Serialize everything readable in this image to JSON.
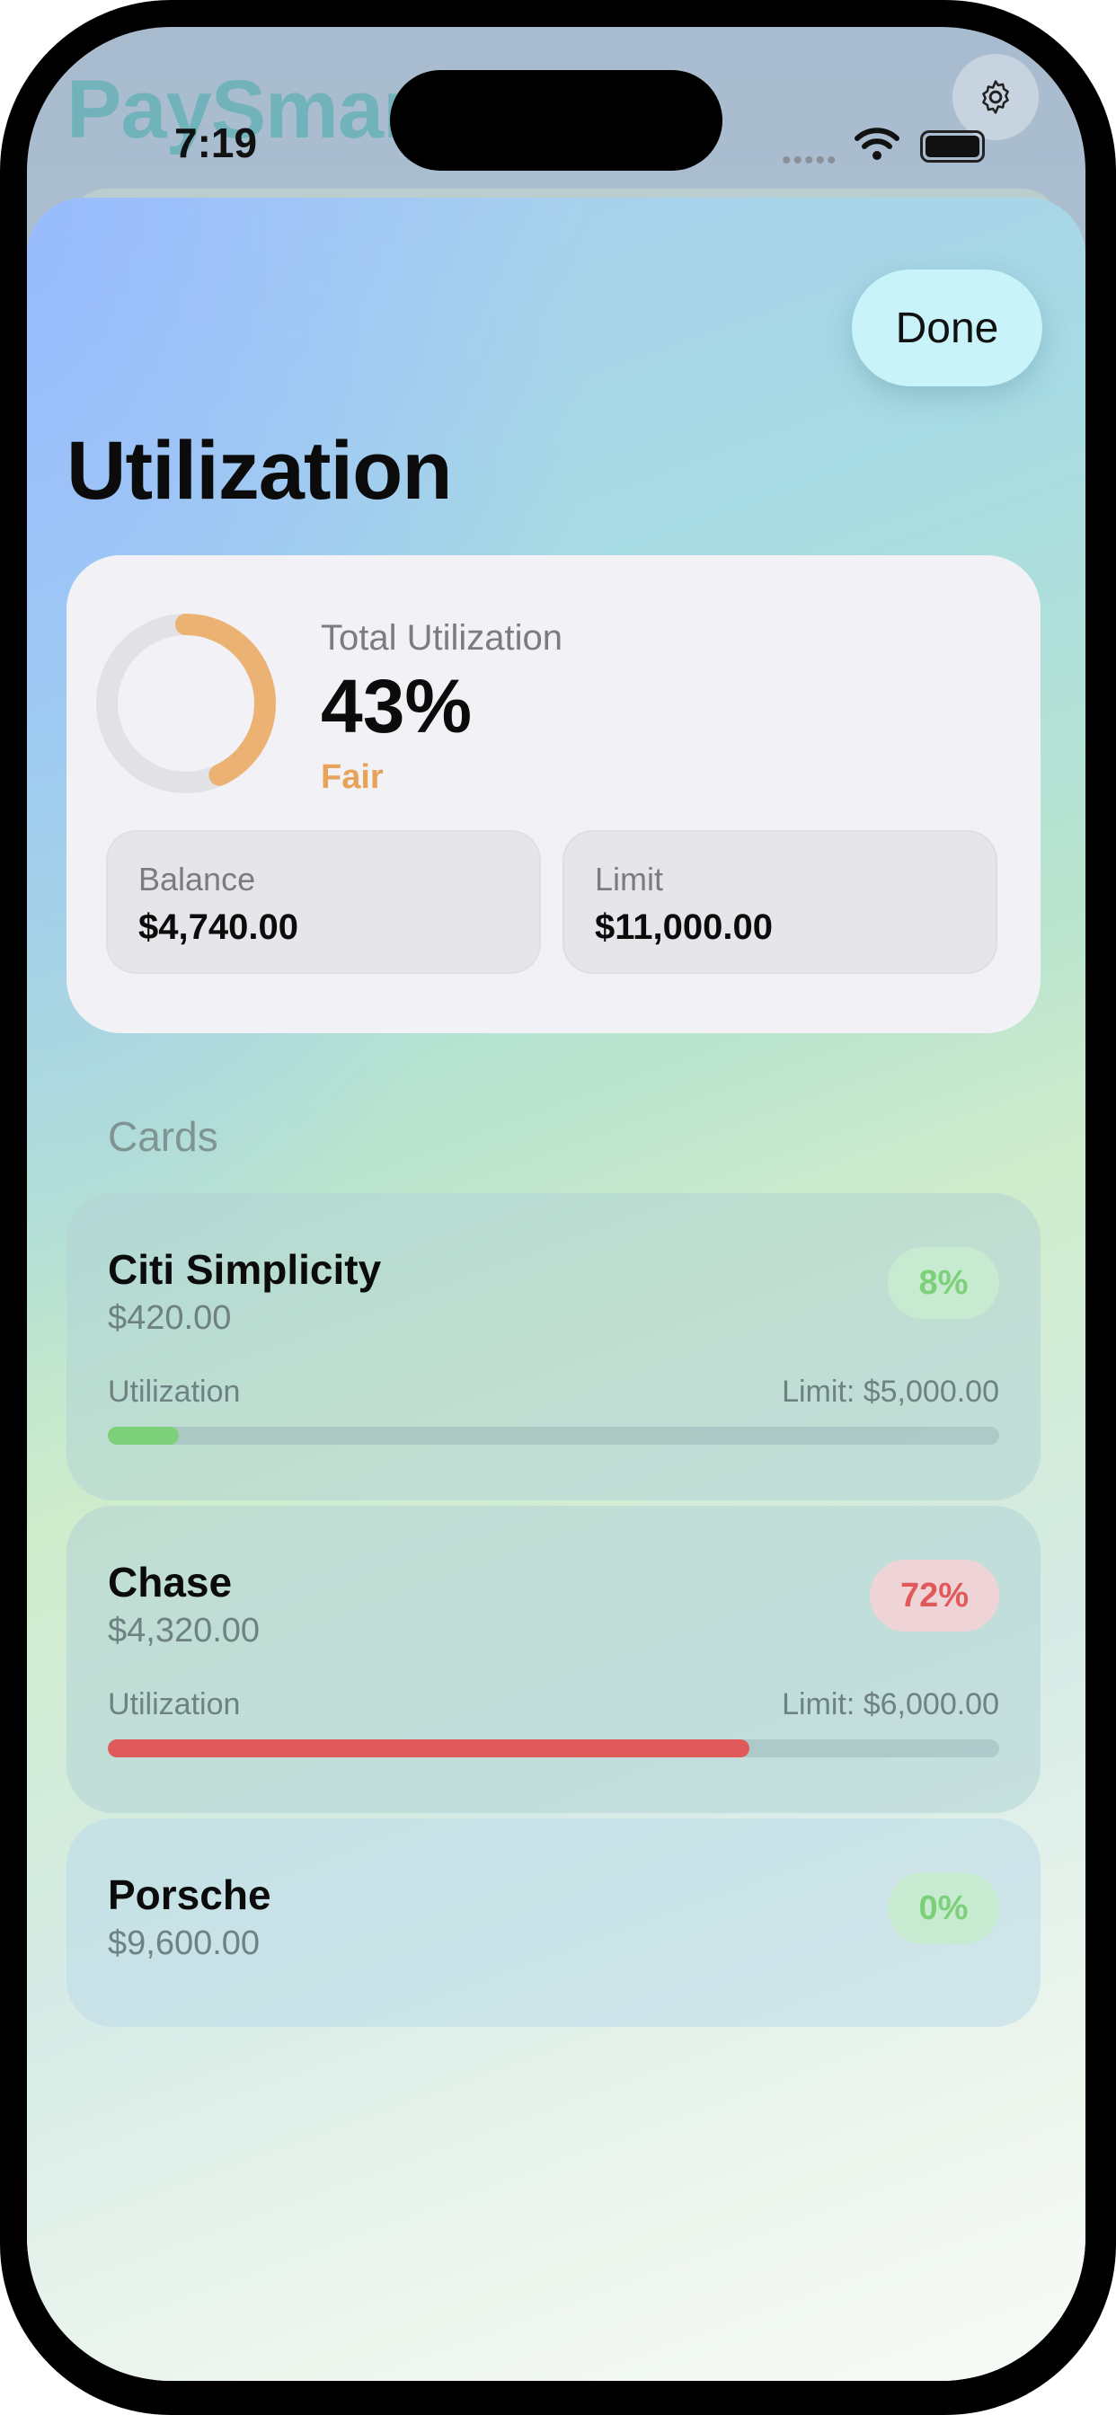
{
  "status_bar": {
    "time": "7:19"
  },
  "background_app": {
    "title": "PaySmart"
  },
  "sheet": {
    "done_label": "Done",
    "title": "Utilization"
  },
  "summary": {
    "label": "Total Utilization",
    "value": "43%",
    "utilization_fraction": 0.43,
    "status": "Fair",
    "balance_label": "Balance",
    "balance_value": "$4,740.00",
    "limit_label": "Limit",
    "limit_value": "$11,000.00"
  },
  "cards_section": {
    "header": "Cards",
    "cards": [
      {
        "name": "Citi Simplicity",
        "balance": "$420.00",
        "badge": "8%",
        "util_label": "Utilization",
        "limit": "Limit: $5,000.00",
        "utilization_fraction": 0.08
      },
      {
        "name": "Chase",
        "balance": "$4,320.00",
        "badge": "72%",
        "util_label": "Utilization",
        "limit": "Limit: $6,000.00",
        "utilization_fraction": 0.72
      },
      {
        "name": "Porsche",
        "balance": "$9,600.00",
        "badge": "0%"
      }
    ]
  },
  "colors": {
    "donut_fill": "#ecb273",
    "donut_track": "#e1e1e6",
    "good": "#7dd07a",
    "good_badge_bg": "#c7ebd0",
    "bad": "#e05a5c",
    "bad_badge_bg": "#efd4d7",
    "fair": "#e8a35a"
  },
  "icons": {
    "settings": "gear-icon",
    "wifi": "wifi-icon",
    "battery": "battery-icon"
  }
}
